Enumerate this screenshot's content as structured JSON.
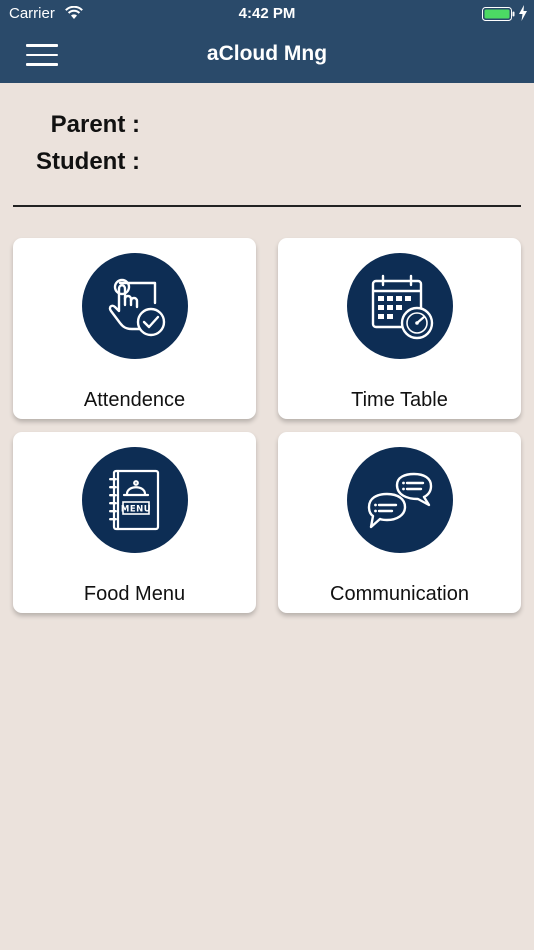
{
  "status_bar": {
    "carrier": "Carrier",
    "time": "4:42 PM"
  },
  "header": {
    "title": "aCloud Mng",
    "background_color": "#2a4a6a"
  },
  "profile": {
    "parent_label": "Parent :",
    "student_label": "Student :"
  },
  "tiles": [
    {
      "label": "Attendence",
      "icon": "attendance-touch-icon"
    },
    {
      "label": "Time Table",
      "icon": "calendar-clock-icon"
    },
    {
      "label": "Food Menu",
      "icon": "menu-book-icon"
    },
    {
      "label": "Communication",
      "icon": "chat-bubbles-icon"
    }
  ],
  "colors": {
    "icon_circle": "#0d2d54",
    "page_background": "#ebe2dc",
    "battery": "#4cd964"
  }
}
